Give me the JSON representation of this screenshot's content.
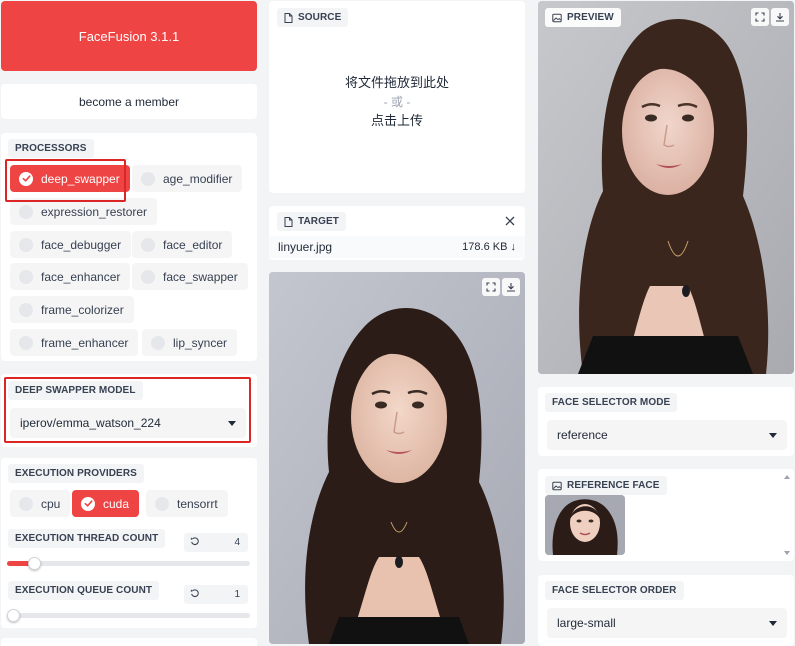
{
  "app": {
    "title": "FaceFusion 3.1.1",
    "member_button": "become a member"
  },
  "processors": {
    "label": "PROCESSORS",
    "items": [
      {
        "label": "deep_swapper",
        "checked": true
      },
      {
        "label": "age_modifier",
        "checked": false
      },
      {
        "label": "expression_restorer",
        "checked": false
      },
      {
        "label": "face_debugger",
        "checked": false
      },
      {
        "label": "face_editor",
        "checked": false
      },
      {
        "label": "face_enhancer",
        "checked": false
      },
      {
        "label": "face_swapper",
        "checked": false
      },
      {
        "label": "frame_colorizer",
        "checked": false
      },
      {
        "label": "frame_enhancer",
        "checked": false
      },
      {
        "label": "lip_syncer",
        "checked": false
      }
    ]
  },
  "deep_swapper_model": {
    "label": "DEEP SWAPPER MODEL",
    "value": "iperov/emma_watson_224"
  },
  "execution_providers": {
    "label": "EXECUTION PROVIDERS",
    "items": [
      {
        "label": "cpu",
        "checked": false
      },
      {
        "label": "cuda",
        "checked": true
      },
      {
        "label": "tensorrt",
        "checked": false
      }
    ]
  },
  "execution_thread_count": {
    "label": "EXECUTION THREAD COUNT",
    "value": "4",
    "fraction": 0.11
  },
  "execution_queue_count": {
    "label": "EXECUTION QUEUE COUNT",
    "value": "1",
    "fraction": 0.0
  },
  "source": {
    "label": "SOURCE",
    "drop_text": "将文件拖放到此处",
    "or_text": "- 或 -",
    "upload_text": "点击上传"
  },
  "target": {
    "label": "TARGET",
    "file_name": "linyuer.jpg",
    "file_size": "178.6 KB ↓"
  },
  "preview": {
    "label": "PREVIEW"
  },
  "face_selector_mode": {
    "label": "FACE SELECTOR MODE",
    "value": "reference"
  },
  "reference_face": {
    "label": "REFERENCE FACE"
  },
  "face_selector_order": {
    "label": "FACE SELECTOR ORDER",
    "value": "large-small"
  },
  "colors": {
    "accent": "#ef4444",
    "highlight_box": "#dc2626",
    "background": "#f3f4f6"
  }
}
